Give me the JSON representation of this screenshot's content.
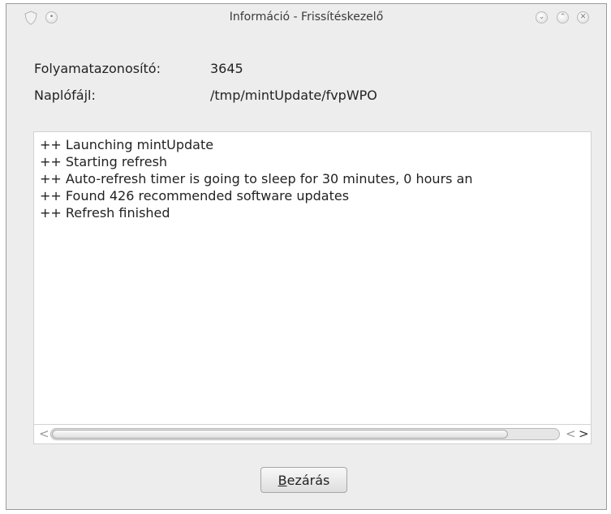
{
  "window": {
    "title": "Információ - Frissítéskezelő"
  },
  "info": {
    "process_id_label": "Folyamatazonosító:",
    "process_id_value": "3645",
    "logfile_label": "Naplófájl:",
    "logfile_value": "/tmp/mintUpdate/fvpWPO"
  },
  "log": {
    "lines": [
      "++ Launching mintUpdate",
      "++ Starting refresh",
      "++ Auto-refresh timer is going to sleep for 30 minutes, 0 hours an",
      "++ Found 426 recommended software updates",
      "++ Refresh finished"
    ]
  },
  "scrollbar": {
    "horizontal_position": 0.0,
    "visible_fraction": 0.9
  },
  "buttons": {
    "close_mnemonic": "B",
    "close_rest": "ezárás"
  },
  "icons": {
    "app": "shield-icon",
    "pin": "pin-icon",
    "minimize": "minimize-icon",
    "maximize": "maximize-icon",
    "close": "close-icon"
  }
}
